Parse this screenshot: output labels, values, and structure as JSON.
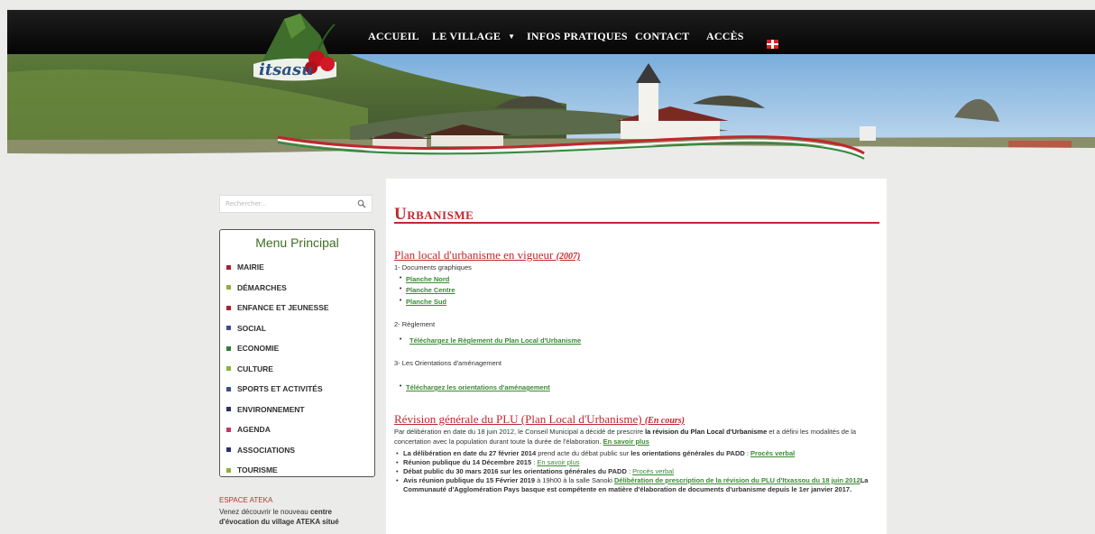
{
  "nav": {
    "items": [
      "ACCUEIL",
      "LE VILLAGE",
      "INFOS PRATIQUES",
      "CONTACT",
      "ACCÈS"
    ]
  },
  "logo": {
    "text": "itsasu"
  },
  "search": {
    "placeholder": "Rechercher..."
  },
  "sidebar": {
    "menu_title": "Menu Principal",
    "items": [
      {
        "label": "MAIRIE",
        "color": "#a8232f"
      },
      {
        "label": "DÉMARCHES",
        "color": "#8bb23a"
      },
      {
        "label": "ENFANCE ET JEUNESSE",
        "color": "#a8232f"
      },
      {
        "label": "SOCIAL",
        "color": "#3b4f8a"
      },
      {
        "label": "ECONOMIE",
        "color": "#2e7d3a"
      },
      {
        "label": "CULTURE",
        "color": "#8bb23a"
      },
      {
        "label": "SPORTS ET ACTIVITÉS",
        "color": "#3b4f8a"
      },
      {
        "label": "ENVIRONNEMENT",
        "color": "#2e2e6e"
      },
      {
        "label": "AGENDA",
        "color": "#c0396b"
      },
      {
        "label": "ASSOCIATIONS",
        "color": "#2e2e6e"
      },
      {
        "label": "TOURISME",
        "color": "#8bb23a"
      }
    ],
    "ateka": {
      "title": "ESPACE ATEKA",
      "line1_a": "Venez découvrir le nouveau ",
      "line1_b": "centre",
      "line2": "d'évocation du village ATEKA situé"
    }
  },
  "main": {
    "title": "Urbanisme",
    "section1": {
      "title": "Plan local d'urbanisme en vigueur",
      "year": "(2007)",
      "docs_label": "1- Documents graphiques",
      "docs": [
        "Planche Nord",
        "Planche Centre",
        "Planche Sud"
      ],
      "reglement_label": "2- Règlement",
      "reglement_link": "Téléchargez le Règlement du Plan Local d'Urbanisme",
      "orient_label": "3- Les Orientations d'aménagement",
      "orient_link": "Téléchargez les orientations d'aménagement"
    },
    "section2": {
      "title": "Révision générale du PLU (Plan Local d'Urbanisme)",
      "status": "(En cours)",
      "intro_a": "Par délibération en date du 18 juin 2012, le Conseil Municipal a décidé de prescrire ",
      "intro_b": "la révision du Plan Local d'Urbanisme",
      "intro_c": " et a défini les modalités de la concertation avec la population durant toute la durée de l'élaboration. ",
      "intro_link": "En savoir plus",
      "b1_a": "La délibération en date du 27 février 2014",
      "b1_b": " prend acte du débat public sur ",
      "b1_c": "les orientations générales du PADD",
      "b1_d": " : ",
      "b1_link": "Procès verbal",
      "b2_a": "Réunion publique du 14 Décembre 2015",
      "b2_b": " : ",
      "b2_link": "En savoir plus",
      "b3_a": "Débat public du 30 mars 2016 sur les orientations générales du PADD",
      "b3_b": " : ",
      "b3_link": "Procès verbal",
      "b4_a": "Avis réunion publique du 15 Février 2019",
      "b4_b": " à 19h00 à la salle Sanoki ",
      "b4_link": "Délibération de prescription de la révision du PLU d'Itxassou du 18 juin 2012",
      "b4_c": "La Communauté d'Agglomération Pays basque est compétente en matière d'élaboration de documents d'urbanisme depuis le 1er janvier 2017."
    }
  }
}
